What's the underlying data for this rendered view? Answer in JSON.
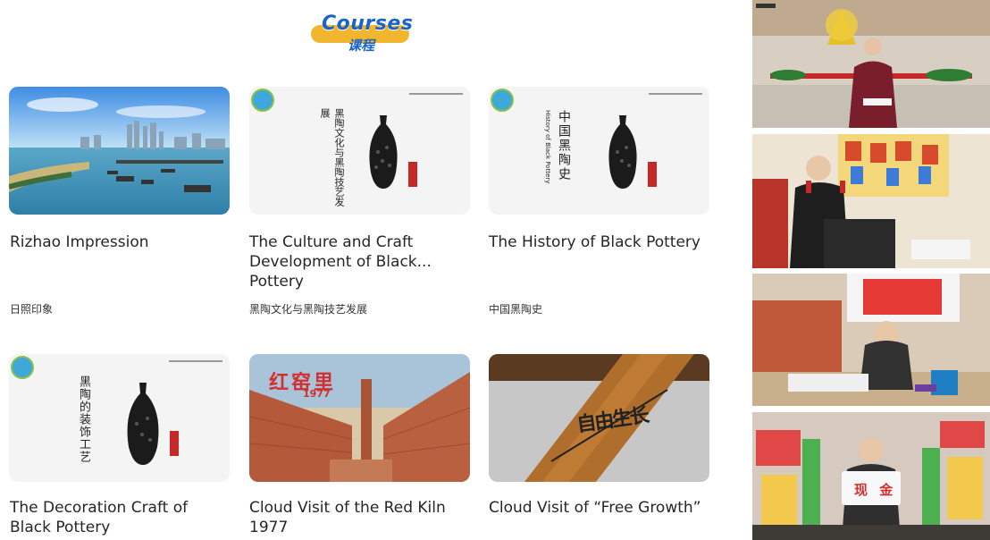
{
  "header": {
    "brand_en": "Courses",
    "brand_cn": "课程"
  },
  "courses": [
    {
      "title": "Rizhao Impression",
      "subtitle": "日照印象"
    },
    {
      "title": "The Culture and Craft Development of Black... Pottery",
      "subtitle": "黑陶文化与黑陶技艺发展"
    },
    {
      "title": "The History of Black Pottery",
      "subtitle": "中国黑陶史"
    },
    {
      "title": "The Decoration Craft of Black Pottery",
      "subtitle": ""
    },
    {
      "title": "Cloud Visit of the Red Kiln 1977",
      "subtitle": ""
    },
    {
      "title": "Cloud Visit of  “Free Growth”",
      "subtitle": ""
    }
  ],
  "thumb_text": {
    "c2_vertical_cn": "黑陶文化与黑陶技艺发展",
    "c3_vertical_cn": "中国黑陶史",
    "c3_vertical_en": "History of Black Pottery",
    "c4_vertical_cn": "黑陶的装饰工艺",
    "c5_overlay": "红窑里",
    "c5_year": "1977",
    "c6_overlay": "自由生长",
    "video4_sign": "现 金"
  },
  "colors": {
    "brand_blue": "#1a63c9",
    "brand_yellow": "#f2b62e",
    "title_text": "#262626"
  }
}
